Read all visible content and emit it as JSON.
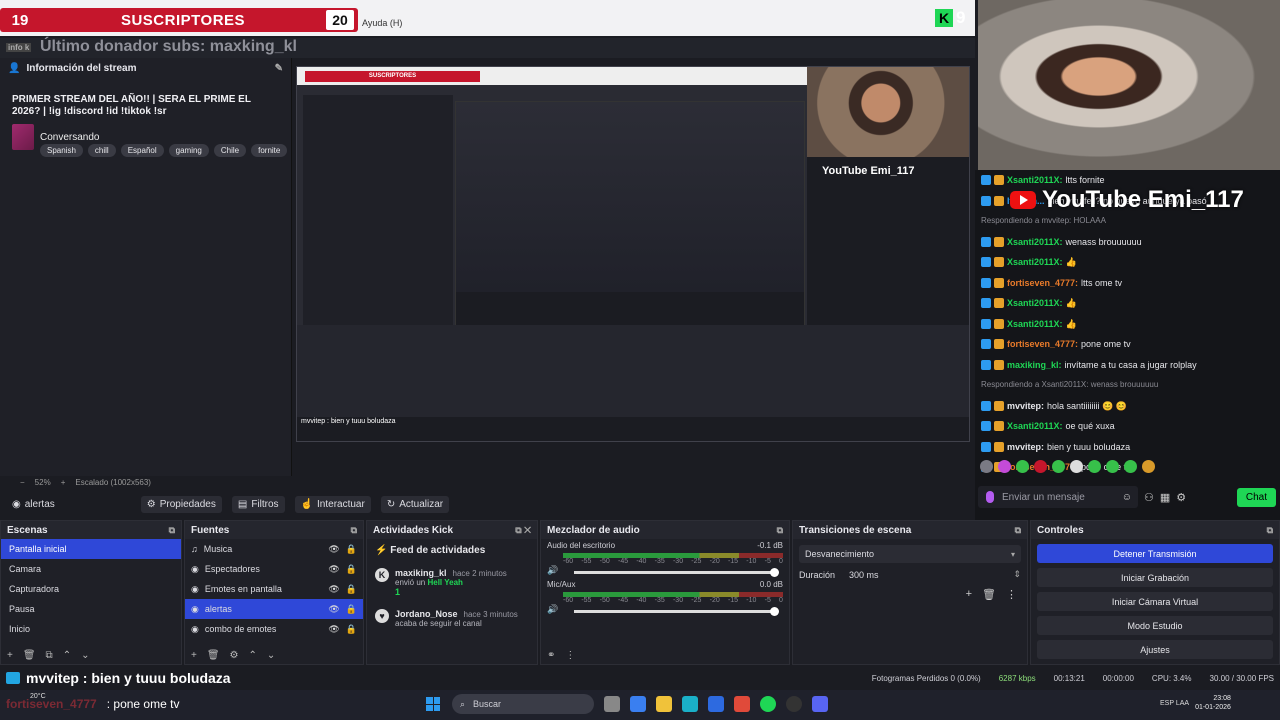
{
  "overlay": {
    "sub_left": "19",
    "sub_label": "SUSCRIPTORES",
    "sub_goal": "20",
    "help_menu": "Ayuda (H)",
    "kick_count": "9",
    "last_donor": "Último donador subs: maxking_kl",
    "info_badge": "info k"
  },
  "stream_info": {
    "header": "Información del stream",
    "title": "PRIMER STREAM DEL AÑO!! | SERA EL PRIME EL 2026? | !ig !discord !id !tiktok !sr",
    "category": "Conversando",
    "tags": [
      "Spanish",
      "chill",
      "Español",
      "gaming",
      "Chile",
      "fornite"
    ]
  },
  "preview": {
    "sub_label": "SUSCRIPTORES",
    "yt_label": "YouTube Emi_117",
    "chat_line": "mvvitep : bien y tuuu boludaza"
  },
  "webcam_overlay": {
    "yt_label": "YouTube Emi_117"
  },
  "chat": {
    "messages": [
      {
        "user": "Xsanti2011X:",
        "msg": "ltts fornite",
        "color": "#1fd655",
        "reply": ""
      },
      {
        "user": "ItsDam...",
        "msg": "bien y tu fell? no nuevo aunque ya pasó",
        "color": "#2d9bf0",
        "reply": ""
      },
      {
        "user": "",
        "msg": "",
        "color": "",
        "reply": "Respondiendo a mvvitep: HOLAAA"
      },
      {
        "user": "Xsanti2011X:",
        "msg": "wenass brouuuuuu",
        "color": "#1fd655",
        "reply": ""
      },
      {
        "user": "Xsanti2011X:",
        "msg": "👍",
        "color": "#1fd655",
        "reply": ""
      },
      {
        "user": "fortiseven_4777:",
        "msg": "ltts ome tv",
        "color": "#e87a2a",
        "reply": ""
      },
      {
        "user": "Xsanti2011X:",
        "msg": "👍",
        "color": "#1fd655",
        "reply": ""
      },
      {
        "user": "Xsanti2011X:",
        "msg": "👍",
        "color": "#1fd655",
        "reply": ""
      },
      {
        "user": "fortiseven_4777:",
        "msg": "pone ome tv",
        "color": "#e87a2a",
        "reply": ""
      },
      {
        "user": "maxiking_kl:",
        "msg": "invítame a tu casa a jugar rolplay",
        "color": "#1fd655",
        "reply": ""
      },
      {
        "user": "",
        "msg": "",
        "color": "",
        "reply": "Respondiendo a Xsanti2011X: wenass brouuuuuu"
      },
      {
        "user": "mvvitep:",
        "msg": "hola santiiiiiiii 😊 😊",
        "color": "#e6e6ea",
        "reply": ""
      },
      {
        "user": "Xsanti2011X:",
        "msg": "oe qué xuxa",
        "color": "#1fd655",
        "reply": ""
      },
      {
        "user": "mvvitep:",
        "msg": "bien y tuuu boludaza",
        "color": "#e6e6ea",
        "reply": ""
      },
      {
        "user": "fortiseven_4777:",
        "msg": "pone ome tv",
        "color": "#e87a2a",
        "reply": ""
      }
    ],
    "input_placeholder": "Enviar un mensaje",
    "send_label": "Chat"
  },
  "status": {
    "zoom": "52%",
    "scale": "Escalado (1002x563)"
  },
  "source_toolbar": {
    "current_source": "alertas",
    "props": "Propiedades",
    "filters": "Filtros",
    "interact": "Interactuar",
    "refresh": "Actualizar"
  },
  "scenes": {
    "title": "Escenas",
    "items": [
      "Pantalla inicial",
      "Camara",
      "Capturadora",
      "Pausa",
      "Inicio"
    ]
  },
  "sources": {
    "title": "Fuentes",
    "items": [
      "Musica",
      "Espectadores",
      "Emotes en pantalla",
      "alertas",
      "combo de emotes"
    ]
  },
  "activity": {
    "title": "Actividades Kick",
    "feed_title": "Feed de actividades",
    "items": [
      {
        "name": "maxiking_kl",
        "time": "hace 2 minutos",
        "line": "envió un",
        "highlight": "Hell Yeah",
        "extra": "1"
      },
      {
        "name": "Jordano_Nose",
        "time": "hace 3 minutos",
        "line": "acaba de seguir el canal",
        "highlight": "",
        "extra": ""
      }
    ]
  },
  "mixer": {
    "title": "Mezclador de audio",
    "channels": [
      {
        "name": "Audio del escritorio",
        "db": "-0.1 dB",
        "level": 0.62
      },
      {
        "name": "Mic/Aux",
        "db": "0.0 dB",
        "level": 0.62
      }
    ],
    "ticks": [
      "-60",
      "-55",
      "-50",
      "-45",
      "-40",
      "-35",
      "-30",
      "-25",
      "-20",
      "-15",
      "-10",
      "-5",
      "0"
    ]
  },
  "transitions": {
    "title": "Transiciones de escena",
    "selected": "Desvanecimiento",
    "duration_label": "Duración",
    "duration_value": "300 ms"
  },
  "controls": {
    "title": "Controles",
    "buttons": [
      "Detener Transmisión",
      "Iniciar Grabación",
      "Iniciar Cámara Virtual",
      "Modo Estudio",
      "Ajustes"
    ]
  },
  "bottom_overlay": {
    "line1": "mvvitep : bien y tuuu boludaza",
    "line2_user": "fortiseven_4777",
    "line2_msg": ": pone ome tv"
  },
  "statusbar": {
    "dropped": "Fotogramas Perdidos 0 (0.0%)",
    "bitrate": "6287 kbps",
    "live": "00:13:21",
    "rec": "00:00:00",
    "cpu": "CPU: 3.4%",
    "fps": "30.00 / 30.00 FPS"
  },
  "taskbar": {
    "weather": "20°C",
    "search": "Buscar",
    "lang": "ESP LAA",
    "time": "23:08",
    "date": "01-01-2026"
  }
}
